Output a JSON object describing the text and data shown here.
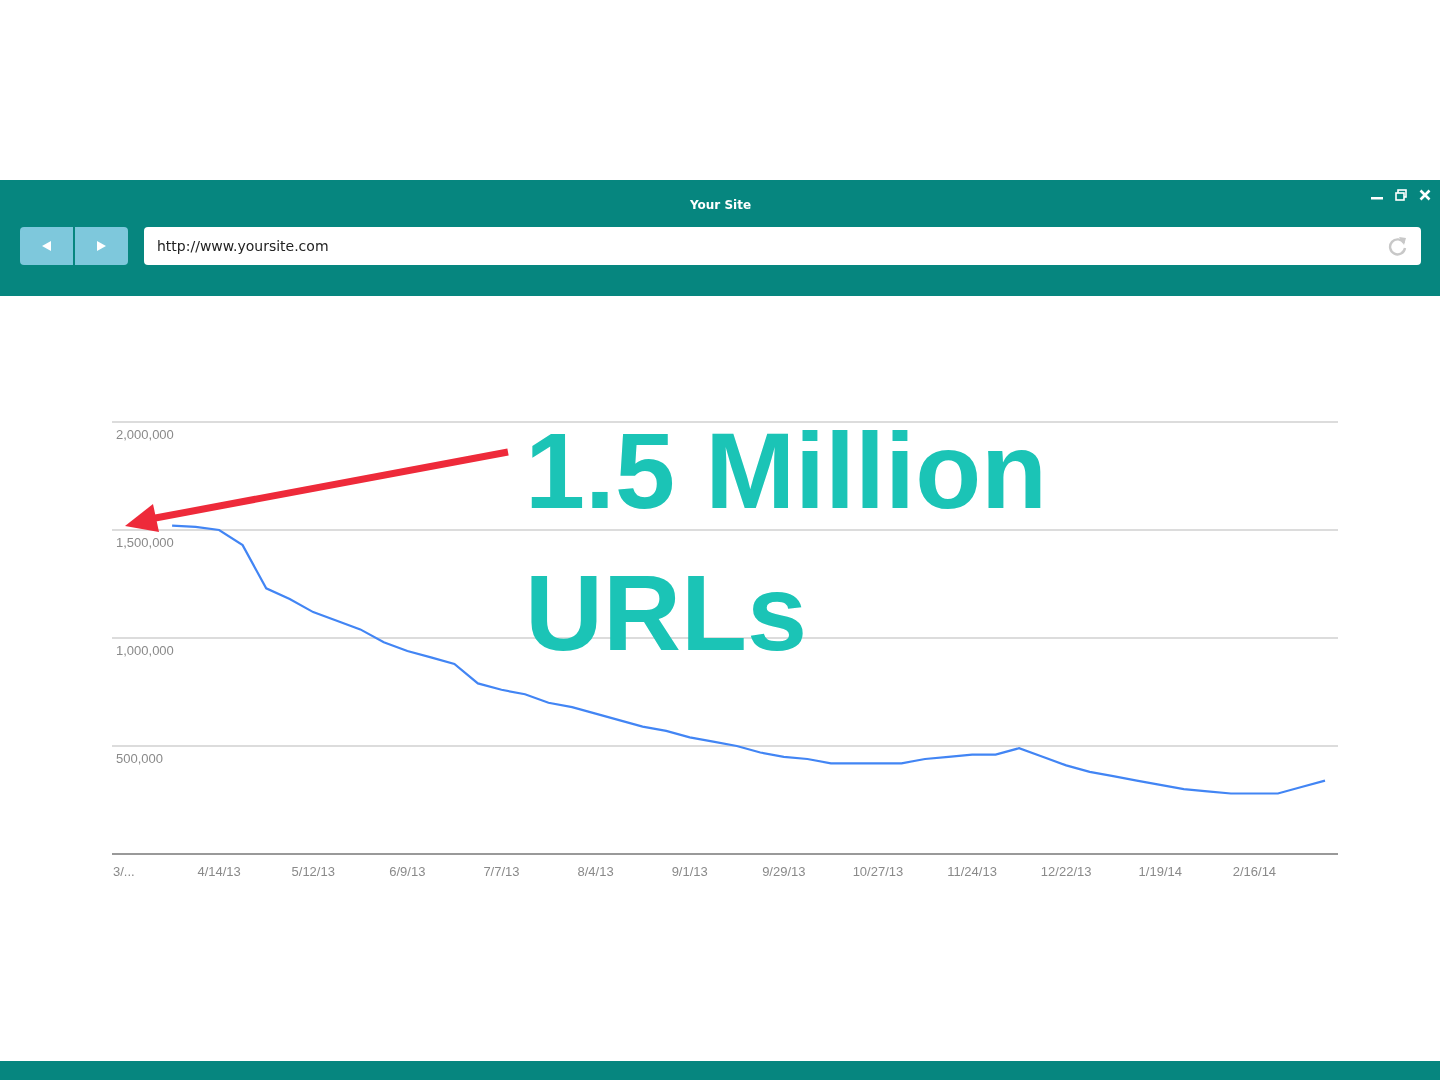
{
  "window": {
    "title": "Your Site",
    "url": "http://www.yoursite.com"
  },
  "callout": {
    "text": "1.5 Million URLs"
  },
  "chart_data": {
    "type": "line",
    "categories": [
      "3/...",
      null,
      null,
      null,
      "4/14/13",
      null,
      null,
      null,
      "5/12/13",
      null,
      null,
      null,
      "6/9/13",
      null,
      null,
      null,
      "7/7/13",
      null,
      null,
      null,
      "8/4/13",
      null,
      null,
      null,
      "9/1/13",
      null,
      null,
      null,
      "9/29/13",
      null,
      null,
      null,
      "10/27/13",
      null,
      null,
      null,
      "11/24/13",
      null,
      null,
      null,
      "12/22/13",
      null,
      null,
      null,
      "1/19/14",
      null,
      null,
      null,
      "2/16/14",
      null,
      null,
      null
    ],
    "series": [
      {
        "color": "#4285f4",
        "values": [
          null,
          null,
          1520000,
          1515000,
          1500000,
          1430000,
          1230000,
          1180000,
          1120000,
          1080000,
          1040000,
          980000,
          940000,
          910000,
          880000,
          790000,
          760000,
          740000,
          700000,
          680000,
          650000,
          620000,
          590000,
          570000,
          540000,
          520000,
          500000,
          470000,
          450000,
          440000,
          420000,
          420000,
          420000,
          420000,
          440000,
          450000,
          460000,
          460000,
          490000,
          450000,
          410000,
          380000,
          360000,
          340000,
          320000,
          300000,
          290000,
          280000,
          280000,
          280000,
          310000,
          340000
        ]
      }
    ],
    "ylim": [
      0,
      2000000
    ],
    "grid": true,
    "yticks": [
      {
        "value": 500000,
        "label": "500,000"
      },
      {
        "value": 1000000,
        "label": "1,000,000"
      },
      {
        "value": 1500000,
        "label": "1,500,000"
      },
      {
        "value": 2000000,
        "label": "2,000,000"
      }
    ]
  }
}
